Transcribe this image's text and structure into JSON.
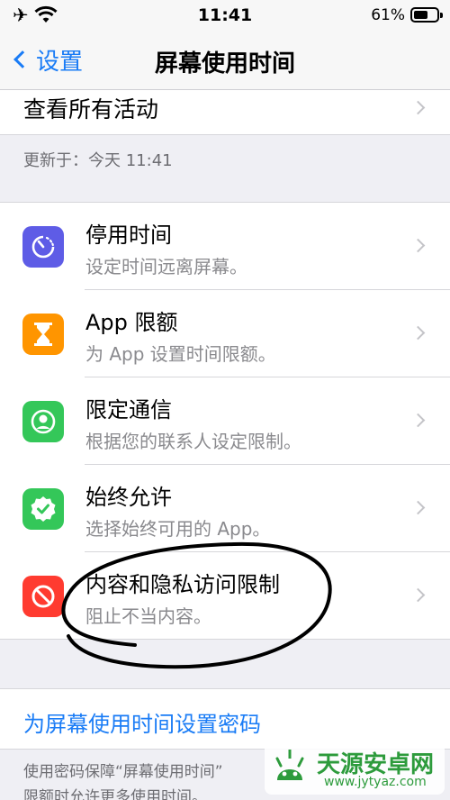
{
  "status_bar": {
    "time": "11:41",
    "battery": "61%",
    "battery_level": 0.61
  },
  "nav": {
    "back_label": "设置",
    "title": "屏幕使用时间"
  },
  "top_row": {
    "label": "查看所有活动"
  },
  "updated": "更新于：今天 11:41",
  "items": [
    {
      "title": "停用时间",
      "subtitle": "设定时间远离屏幕。",
      "icon": "downtime-icon",
      "color": "#5e5ce6"
    },
    {
      "title": "App 限额",
      "subtitle": "为 App 设置时间限额。",
      "icon": "hourglass-icon",
      "color": "#ff9500"
    },
    {
      "title": "限定通信",
      "subtitle": "根据您的联系人设定限制。",
      "icon": "contact-icon",
      "color": "#34c759"
    },
    {
      "title": "始终允许",
      "subtitle": "选择始终可用的 App。",
      "icon": "checkmark-badge-icon",
      "color": "#34c759"
    },
    {
      "title": "内容和隐私访问限制",
      "subtitle": "阻止不当内容。",
      "icon": "restriction-icon",
      "color": "#ff3b30"
    }
  ],
  "passcode": {
    "label": "为屏幕使用时间设置密码"
  },
  "footer": {
    "line1": "使用密码保障“屏幕使用时间”",
    "line2": "限额时允许更多使用时间。"
  },
  "watermark": {
    "name": "天源安卓网",
    "url": "www.jytyaz.com"
  },
  "colors": {
    "accent": "#1a7cf6",
    "brand": "#2d9b3c"
  }
}
